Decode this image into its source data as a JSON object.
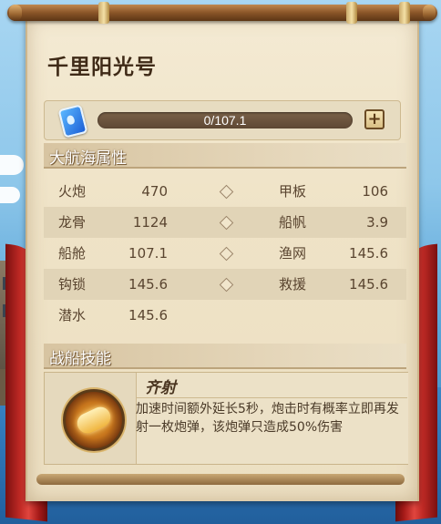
{
  "ship": {
    "name": "千里阳光号"
  },
  "progress": {
    "current": 0,
    "max": 107.1,
    "label": "0/107.1",
    "plus_symbol": "+"
  },
  "attributes": {
    "header": "大航海属性",
    "rows": [
      {
        "left_name": "火炮",
        "left_value": "470",
        "right_name": "甲板",
        "right_value": "106"
      },
      {
        "left_name": "龙骨",
        "left_value": "1124",
        "right_name": "船帆",
        "right_value": "3.9"
      },
      {
        "left_name": "船舱",
        "left_value": "107.1",
        "right_name": "渔网",
        "right_value": "145.6"
      },
      {
        "left_name": "钩锁",
        "left_value": "145.6",
        "right_name": "救援",
        "right_value": "145.6"
      },
      {
        "left_name": "潜水",
        "left_value": "145.6"
      }
    ]
  },
  "skill": {
    "header": "战船技能",
    "name": "齐射",
    "description": "加速时间额外延长5秒，炮击时有概率立即再发射一枚炮弹，该炮弹只造成50%伤害"
  },
  "colors": {
    "title": "#3f2a17",
    "curtain": "#c02a25",
    "bar_bg": "#6a523c",
    "parchment": "#efe3c7"
  },
  "icons": [
    "blue-gem-icon",
    "plus-icon",
    "diamond-icon",
    "cannon-skill-icon"
  ]
}
